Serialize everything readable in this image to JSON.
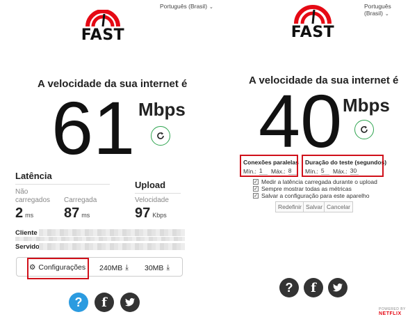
{
  "left": {
    "language": "Português (Brasil)",
    "logo_text": "FAST",
    "headline": "A velocidade da sua internet é",
    "speed_value": "61",
    "speed_unit": "Mbps",
    "latency": {
      "title": "Latência",
      "unloaded_label": "Não carregados",
      "unloaded_value": "2",
      "unloaded_unit": "ms",
      "loaded_label": "Carregada",
      "loaded_value": "87",
      "loaded_unit": "ms"
    },
    "upload": {
      "title": "Upload",
      "speed_label": "Velocidade",
      "speed_value": "97",
      "speed_unit": "Kbps"
    },
    "client_label": "Cliente",
    "server_label": "Servidor",
    "settings_label": "Configurações",
    "download_1": "240MB",
    "download_2": "30MB",
    "social": {
      "help": "?",
      "facebook": "f",
      "twitter": "t"
    }
  },
  "right": {
    "language": "Português (Brasil)",
    "logo_text": "FAST",
    "headline": "A velocidade da sua internet é",
    "speed_value": "40",
    "speed_unit": "Mbps",
    "parallel": {
      "title": "Conexões paralelas",
      "min_label": "Mín.:",
      "min_value": "1",
      "max_label": "Máx.:",
      "max_value": "8"
    },
    "duration": {
      "title": "Duração do teste (segundos)",
      "min_label": "Mín.:",
      "min_value": "5",
      "max_label": "Máx.:",
      "max_value": "30"
    },
    "options": [
      "Medir a latência carregada durante o upload",
      "Sempre mostrar todas as métricas",
      "Salvar a configuração para este aparelho"
    ],
    "buttons": {
      "reset": "Redefinir",
      "save": "Salvar",
      "cancel": "Cancelar"
    },
    "social": {
      "help": "?",
      "facebook": "f",
      "twitter": "t"
    },
    "powered_by": "POWERED BY",
    "brand": "NETFLIX"
  },
  "colors": {
    "brand_red": "#e50914",
    "refresh_green": "#2ea44f",
    "help_blue": "#2b9be0",
    "social_dark": "#333333",
    "highlight_red": "#d0101a"
  }
}
